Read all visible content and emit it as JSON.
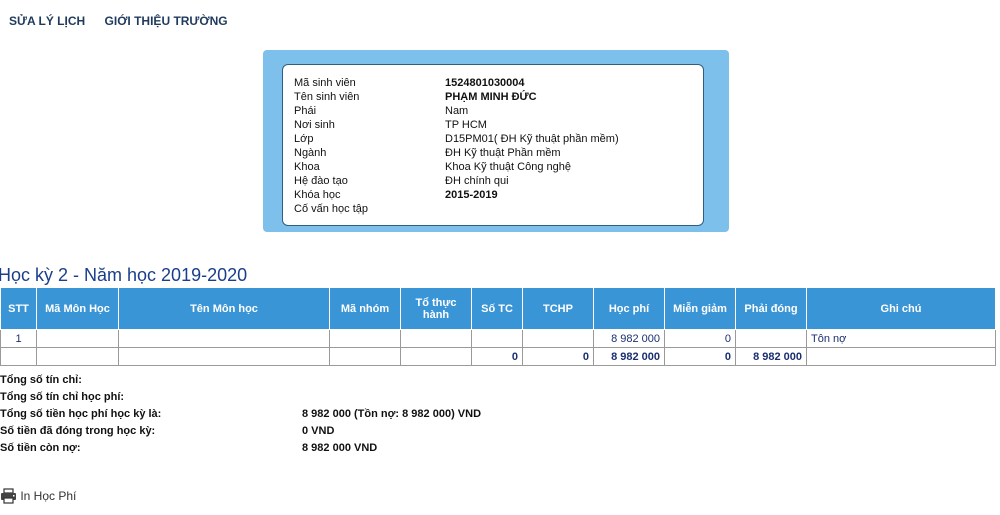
{
  "nav": {
    "items": [
      "SỬA LÝ LỊCH",
      "GIỚI THIỆU TRƯỜNG"
    ]
  },
  "student": {
    "rows": [
      {
        "label": "Mã sinh viên",
        "value": "1524801030004",
        "bold": true
      },
      {
        "label": "Tên sinh viên",
        "value": "PHẠM MINH ĐỨC",
        "bold": true
      },
      {
        "label": "Phái",
        "value": "Nam",
        "bold": false
      },
      {
        "label": "Nơi sinh",
        "value": "TP HCM",
        "bold": false
      },
      {
        "label": "Lớp",
        "value": "D15PM01( ĐH Kỹ thuật phần mềm)",
        "bold": false
      },
      {
        "label": "Ngành",
        "value": "ĐH Kỹ thuật Phần mềm",
        "bold": false
      },
      {
        "label": "Khoa",
        "value": "Khoa Kỹ thuật Công nghệ",
        "bold": false
      },
      {
        "label": "Hệ đào tạo",
        "value": "ĐH chính qui",
        "bold": false
      },
      {
        "label": "Khóa học",
        "value": "2015-2019",
        "bold": true
      },
      {
        "label": "Cố vấn học tập",
        "value": "",
        "bold": false
      }
    ]
  },
  "semester": {
    "title": "Học kỳ 2 - Năm học 2019-2020"
  },
  "table": {
    "headers": [
      "STT",
      "Mã Môn Học",
      "Tên Môn học",
      "Mã nhóm",
      "Tổ thực hành",
      "Số TC",
      "TCHP",
      "Học phí",
      "Miễn giảm",
      "Phải đóng",
      "Ghi chú"
    ],
    "rows": [
      [
        "1",
        "",
        "",
        "",
        "",
        "",
        "",
        "8 982 000",
        "0",
        "",
        "Tôn nợ"
      ]
    ],
    "total": [
      "",
      "",
      "",
      "",
      "",
      "0",
      "0",
      "8 982 000",
      "0",
      "8 982 000",
      ""
    ]
  },
  "summary": {
    "rows": [
      {
        "label": "Tổng số tín chỉ:",
        "value": ""
      },
      {
        "label": "Tổng số tín chỉ học phí:",
        "value": ""
      },
      {
        "label": "Tổng số tiền học phí học kỳ là:",
        "value": "8 982 000 (Tồn nợ: 8 982 000) VND"
      },
      {
        "label": "Số tiền đã đóng trong học kỳ:",
        "value": "0 VND"
      },
      {
        "label": "Số tiền còn nợ:",
        "value": "8 982 000 VND"
      }
    ]
  },
  "print": {
    "label": "In Học Phí",
    "icon": "printer-icon"
  }
}
